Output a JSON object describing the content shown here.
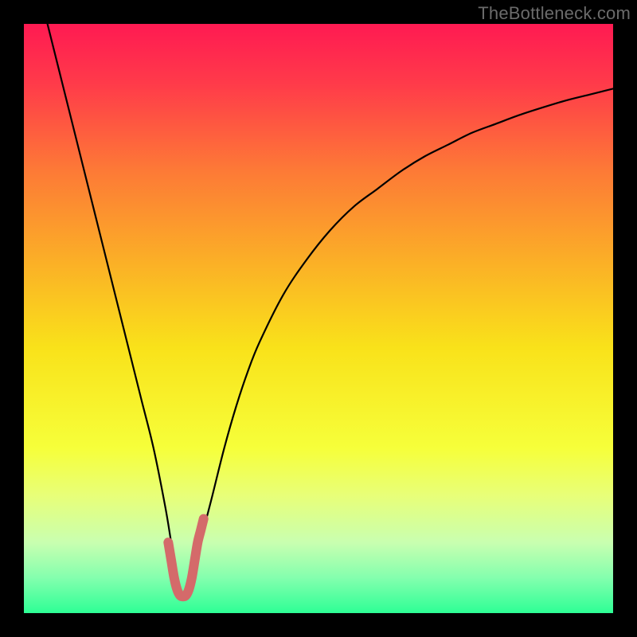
{
  "watermark": {
    "text": "TheBottleneck.com"
  },
  "gradient": {
    "stops": [
      {
        "offset": 0.0,
        "color": "#ff1a52"
      },
      {
        "offset": 0.1,
        "color": "#ff3a4a"
      },
      {
        "offset": 0.25,
        "color": "#fd7a36"
      },
      {
        "offset": 0.4,
        "color": "#fbae27"
      },
      {
        "offset": 0.55,
        "color": "#f9e21a"
      },
      {
        "offset": 0.72,
        "color": "#f6ff3a"
      },
      {
        "offset": 0.8,
        "color": "#e8ff78"
      },
      {
        "offset": 0.88,
        "color": "#c9ffb0"
      },
      {
        "offset": 0.94,
        "color": "#84ffae"
      },
      {
        "offset": 1.0,
        "color": "#2dff95"
      }
    ]
  },
  "chart_data": {
    "type": "line",
    "title": "",
    "xlabel": "",
    "ylabel": "",
    "xlim": [
      0,
      100
    ],
    "ylim": [
      0,
      100
    ],
    "series": [
      {
        "name": "bottleneck-curve",
        "color": "#000000",
        "x": [
          4,
          6,
          8,
          10,
          12,
          14,
          16,
          18,
          20,
          22,
          24,
          25,
          26,
          27,
          28,
          29,
          30,
          32,
          34,
          36,
          38,
          40,
          44,
          48,
          52,
          56,
          60,
          64,
          68,
          72,
          76,
          80,
          84,
          88,
          92,
          96,
          100
        ],
        "values": [
          100,
          92,
          84,
          76,
          68,
          60,
          52,
          44,
          36,
          28,
          18,
          12,
          6,
          3,
          3,
          6,
          12,
          20,
          28,
          35,
          41,
          46,
          54,
          60,
          65,
          69,
          72,
          75,
          77.5,
          79.5,
          81.5,
          83,
          84.5,
          85.8,
          87,
          88,
          89
        ]
      },
      {
        "name": "highlight-bottom",
        "color": "#d46a6a",
        "stroke_width": 12,
        "x": [
          24.5,
          25,
          25.5,
          26,
          26.5,
          27,
          27.5,
          28,
          28.5,
          29,
          29.5,
          30,
          30.5
        ],
        "values": [
          12,
          9,
          6,
          4,
          3,
          2.8,
          3,
          4,
          6,
          9,
          12,
          14,
          16
        ]
      }
    ]
  }
}
